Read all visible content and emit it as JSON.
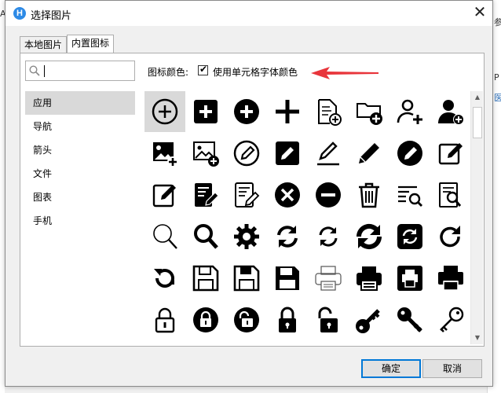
{
  "window": {
    "title": "选择图片",
    "logo_letter": "H",
    "close_symbol": "✕"
  },
  "tabs": [
    {
      "label": "本地图片",
      "active": false
    },
    {
      "label": "内置图标",
      "active": true
    }
  ],
  "search": {
    "value": "",
    "placeholder": ""
  },
  "categories": [
    {
      "label": "应用",
      "selected": true
    },
    {
      "label": "导航",
      "selected": false
    },
    {
      "label": "箭头",
      "selected": false
    },
    {
      "label": "文件",
      "selected": false
    },
    {
      "label": "图表",
      "selected": false
    },
    {
      "label": "手机",
      "selected": false
    }
  ],
  "icon_color": {
    "label": "图标颜色:",
    "checkbox_label": "使用单元格字体颜色",
    "checked": true,
    "check_symbol": "✔"
  },
  "annotation_arrow_color": "#e8353b",
  "icons": [
    [
      "plus-circle-outline",
      "plus-square",
      "plus-circle-filled",
      "plus",
      "file-plus",
      "folder-plus",
      "user-plus-outline",
      "user-plus-filled"
    ],
    [
      "image-plus-filled",
      "image-plus-outline",
      "pencil-circle-outline",
      "pencil-square-filled",
      "pencil-line",
      "pencil",
      "pencil-circle-filled",
      "edit-square-outline"
    ],
    [
      "edit-square-pencil",
      "document-edit-filled",
      "document-edit-outline",
      "close-circle",
      "minus-circle",
      "trash",
      "list-search",
      "document-search"
    ],
    [
      "magnifier-outline",
      "magnifier-bold",
      "gear",
      "refresh-arrows",
      "refresh-circle-outline",
      "refresh-arrows-bold",
      "refresh-square",
      "redo-circle"
    ],
    [
      "reload-circle",
      "floppy-outline",
      "floppy-outline-2",
      "floppy-filled",
      "printer-outline",
      "printer-filled",
      "printer-square",
      "printer-bold"
    ],
    [
      "padlock-outline",
      "padlock-circle",
      "unlock-circle",
      "padlock-filled",
      "unlock-filled",
      "key-circle",
      "key-filled",
      "key-outline"
    ]
  ],
  "scrollbar": {
    "up_symbol": "▲",
    "down_symbol": "▼"
  },
  "buttons": {
    "ok": "确定",
    "cancel": "取消"
  },
  "background": {
    "char_left": "A",
    "char_right_1": "参",
    "char_right_2": "P",
    "char_right_3": "医"
  },
  "colors": {
    "selection": "#d9d9d9",
    "accent": "#0078d7",
    "icon": "#000000"
  }
}
